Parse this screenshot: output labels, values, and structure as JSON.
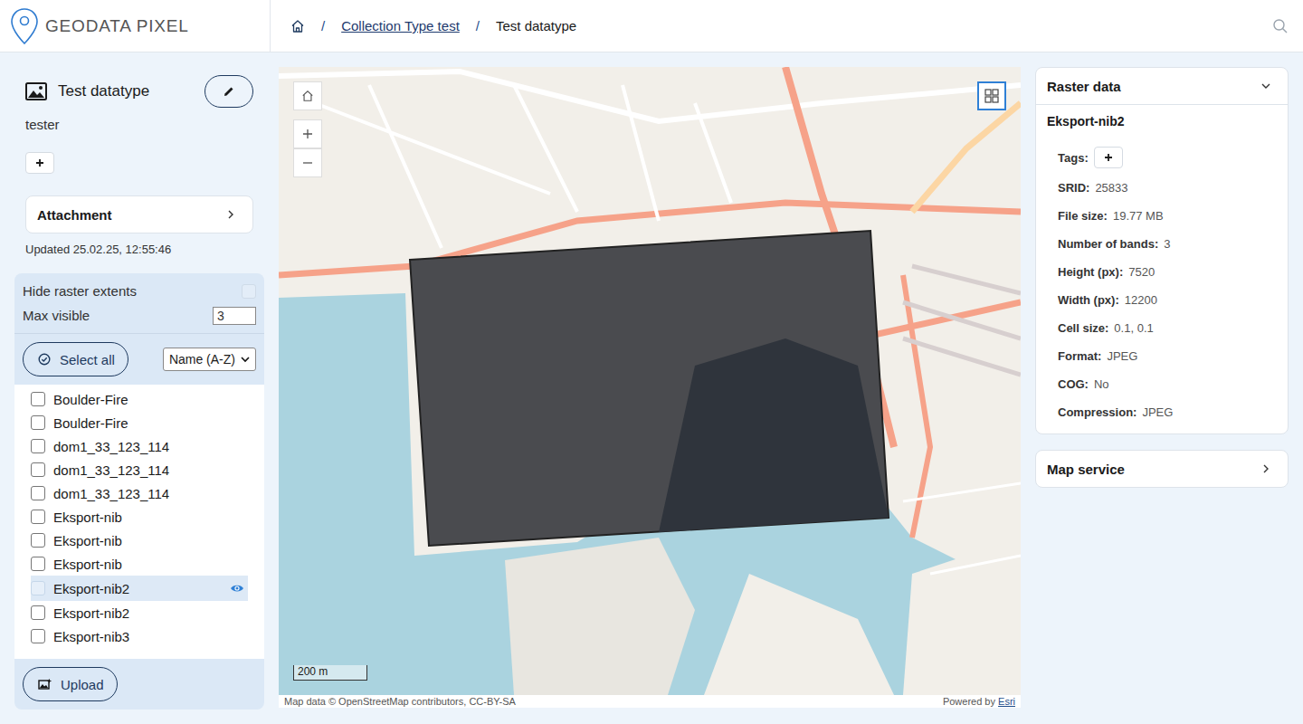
{
  "app": {
    "name": "GEODATA PIXEL"
  },
  "breadcrumb": {
    "separator": "/",
    "items": [
      {
        "label": "Collection Type test",
        "link": true
      },
      {
        "label": "Test datatype",
        "link": false
      }
    ]
  },
  "datatype": {
    "title": "Test datatype",
    "description": "tester"
  },
  "attachment": {
    "label": "Attachment",
    "expanded": false
  },
  "updated": "Updated 25.02.25, 12:55:46",
  "options": {
    "hide_extents_label": "Hide raster extents",
    "hide_extents_checked": false,
    "max_visible_label": "Max visible",
    "max_visible_value": "3"
  },
  "select_all": "Select all",
  "sort": {
    "value": "Name (A-Z)"
  },
  "rasters": [
    {
      "name": "Boulder-Fire",
      "checked": false,
      "selected": false,
      "visible": false
    },
    {
      "name": "Boulder-Fire",
      "checked": false,
      "selected": false,
      "visible": false
    },
    {
      "name": "dom1_33_123_114",
      "checked": false,
      "selected": false,
      "visible": false
    },
    {
      "name": "dom1_33_123_114",
      "checked": false,
      "selected": false,
      "visible": false
    },
    {
      "name": "dom1_33_123_114",
      "checked": false,
      "selected": false,
      "visible": false
    },
    {
      "name": "Eksport-nib",
      "checked": false,
      "selected": false,
      "visible": false
    },
    {
      "name": "Eksport-nib",
      "checked": false,
      "selected": false,
      "visible": false
    },
    {
      "name": "Eksport-nib",
      "checked": false,
      "selected": false,
      "visible": false
    },
    {
      "name": "Eksport-nib2",
      "checked": false,
      "selected": true,
      "visible": true
    },
    {
      "name": "Eksport-nib2",
      "checked": false,
      "selected": false,
      "visible": false
    },
    {
      "name": "Eksport-nib3",
      "checked": false,
      "selected": false,
      "visible": false
    }
  ],
  "upload": "Upload",
  "map": {
    "scale": "200 m",
    "attribution": "Map data © OpenStreetMap contributors, CC-BY-SA",
    "powered_by": "Powered by",
    "powered_by_link": "Esri"
  },
  "raster_panel": {
    "title": "Raster data",
    "expanded": true,
    "name": "Eksport-nib2",
    "tags_label": "Tags:",
    "properties": [
      {
        "label": "SRID:",
        "value": "25833"
      },
      {
        "label": "File size:",
        "value": "19.77 MB"
      },
      {
        "label": "Number of bands:",
        "value": "3"
      },
      {
        "label": "Height (px):",
        "value": "7520"
      },
      {
        "label": "Width (px):",
        "value": "12200"
      },
      {
        "label": "Cell size:",
        "value": "0.1, 0.1"
      },
      {
        "label": "Format:",
        "value": "JPEG"
      },
      {
        "label": "COG:",
        "value": "No"
      },
      {
        "label": "Compression:",
        "value": "JPEG"
      }
    ]
  },
  "map_service": {
    "title": "Map service",
    "expanded": false
  }
}
